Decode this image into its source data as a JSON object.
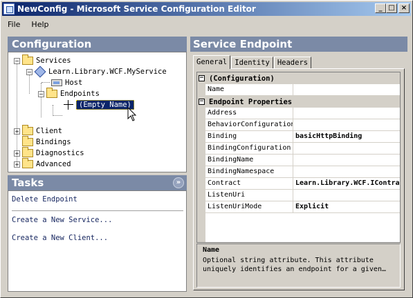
{
  "window": {
    "title": "NewConfig - Microsoft Service Configuration Editor",
    "minimize": "_",
    "maximize": "□",
    "close": "×"
  },
  "menu": {
    "file": "File",
    "help": "Help"
  },
  "configuration": {
    "header": "Configuration",
    "tree": {
      "services": "Services",
      "service_name": "Learn.Library.WCF.MyService",
      "host": "Host",
      "endpoints": "Endpoints",
      "empty_name": "(Empty Name)",
      "client": "Client",
      "bindings": "Bindings",
      "diagnostics": "Diagnostics",
      "advanced": "Advanced"
    }
  },
  "tasks": {
    "header": "Tasks",
    "collapse": "»",
    "items": [
      "Delete Endpoint",
      "Create a New Service...",
      "Create a New Client..."
    ]
  },
  "endpoint": {
    "header": "Service Endpoint",
    "tabs": [
      "General",
      "Identity",
      "Headers"
    ],
    "grid": {
      "cat1": "(Configuration)",
      "cat2": "Endpoint Properties",
      "rows": [
        {
          "name": "Name",
          "value": ""
        },
        {
          "name": "Address",
          "value": ""
        },
        {
          "name": "BehaviorConfiguration",
          "value": ""
        },
        {
          "name": "Binding",
          "value": "basicHttpBinding"
        },
        {
          "name": "BindingConfiguration",
          "value": ""
        },
        {
          "name": "BindingName",
          "value": ""
        },
        {
          "name": "BindingNamespace",
          "value": ""
        },
        {
          "name": "Contract",
          "value": "Learn.Library.WCF.IContract"
        },
        {
          "name": "ListenUri",
          "value": ""
        },
        {
          "name": "ListenUriMode",
          "value": "Explicit"
        }
      ]
    },
    "description": {
      "title": "Name",
      "text": "Optional string attribute. This attribute uniquely identifies an endpoint for a given…"
    }
  }
}
